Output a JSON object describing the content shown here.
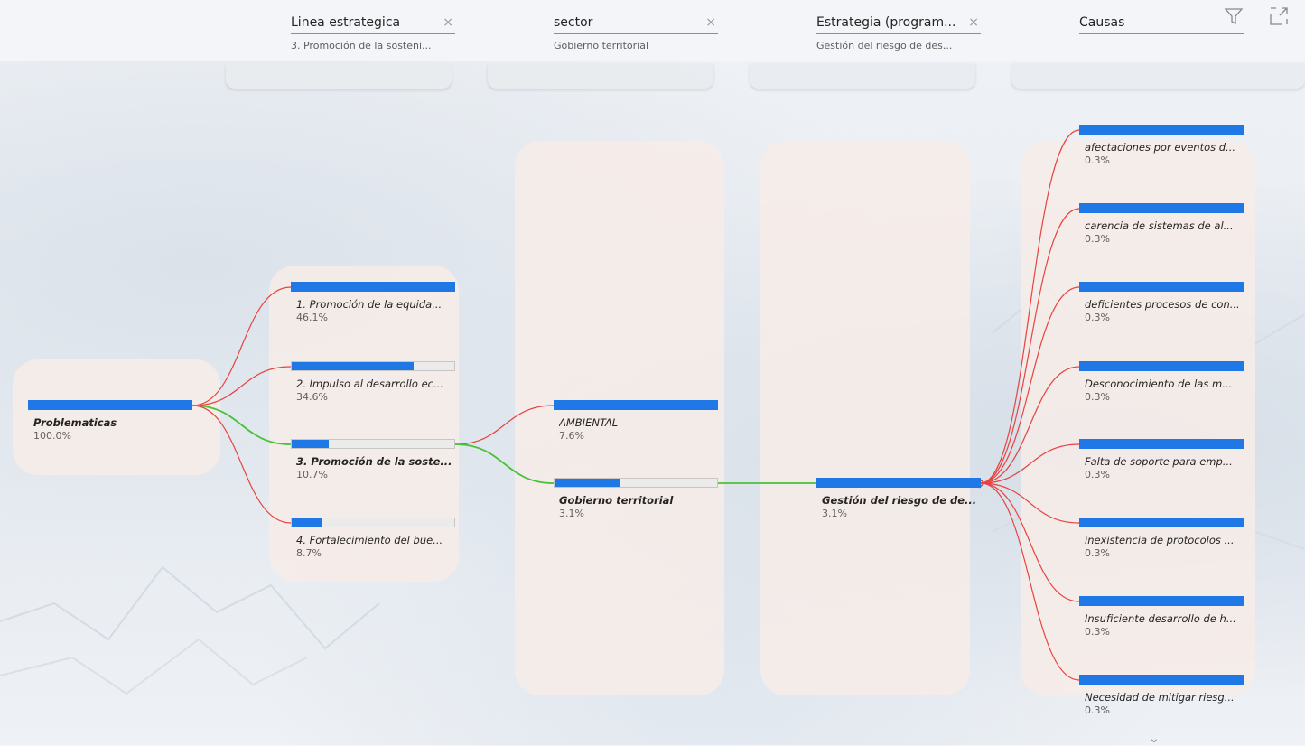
{
  "header": [
    {
      "title": "Linea estrategica",
      "subtitle": "3. Promoción de la sosteni...",
      "closable": true
    },
    {
      "title": "sector",
      "subtitle": "Gobierno territorial",
      "closable": true
    },
    {
      "title": "Estrategia (program...",
      "subtitle": "Gestión del riesgo de des...",
      "closable": true
    },
    {
      "title": "Causas",
      "subtitle": "",
      "closable": false
    }
  ],
  "icons": {
    "filter": "filter-icon",
    "expand": "focus-mode-icon"
  },
  "colors": {
    "bar": "#1f78e6",
    "active_path": "#4ac23a",
    "inactive_path": "#e8423f"
  },
  "root": {
    "label": "Problematicas",
    "percent": "100.0%"
  },
  "level1": [
    {
      "label": "1. Promoción de la equida...",
      "percent": "46.1%",
      "fraction": 1.0
    },
    {
      "label": "2. Impulso al desarrollo ec...",
      "percent": "34.6%",
      "fraction": 0.75
    },
    {
      "label": "3. Promoción de la soste...",
      "percent": "10.7%",
      "fraction": 0.23,
      "selected": true
    },
    {
      "label": "4. Fortalecimiento del bue...",
      "percent": "8.7%",
      "fraction": 0.19
    }
  ],
  "level2": [
    {
      "label": "AMBIENTAL",
      "percent": "7.6%",
      "fraction": 1.0
    },
    {
      "label": "Gobierno territorial",
      "percent": "3.1%",
      "fraction": 0.4,
      "selected": true
    }
  ],
  "level3": [
    {
      "label": "Gestión del riesgo de de...",
      "percent": "3.1%",
      "fraction": 1.0,
      "selected": true
    }
  ],
  "level4": [
    {
      "label": "afectaciones por eventos d...",
      "percent": "0.3%",
      "fraction": 1.0
    },
    {
      "label": "carencia de sistemas de al...",
      "percent": "0.3%",
      "fraction": 1.0
    },
    {
      "label": "deficientes procesos de con...",
      "percent": "0.3%",
      "fraction": 1.0
    },
    {
      "label": "Desconocimiento de las m...",
      "percent": "0.3%",
      "fraction": 1.0
    },
    {
      "label": "Falta de soporte para emp...",
      "percent": "0.3%",
      "fraction": 1.0
    },
    {
      "label": "inexistencia de protocolos ...",
      "percent": "0.3%",
      "fraction": 1.0
    },
    {
      "label": "Insuficiente desarrollo de h...",
      "percent": "0.3%",
      "fraction": 1.0
    },
    {
      "label": "Necesidad de mitigar riesg...",
      "percent": "0.3%",
      "fraction": 1.0
    }
  ]
}
